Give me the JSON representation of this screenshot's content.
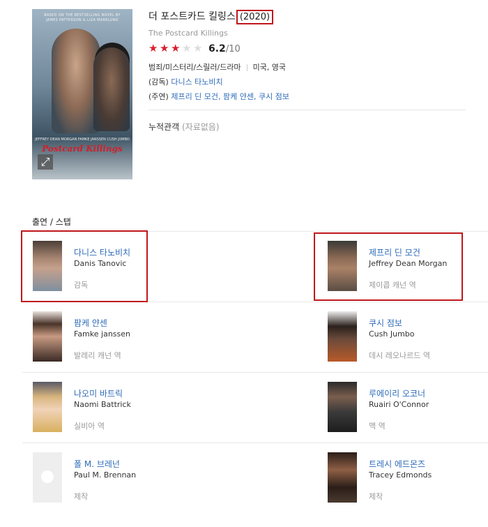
{
  "movie": {
    "title_ko": "더 포스트카드 킬링스",
    "year": "(2020)",
    "title_en": "The Postcard Killings",
    "rating": 6.2,
    "rating_score": "6.2",
    "rating_max": "/10",
    "genres": "범죄/미스터리/스릴러/드라마",
    "countries": "미국, 영국",
    "director_label": "(감독)",
    "director": "다니스 타노비치",
    "cast_label": "(주연)",
    "cast_list": "제프리 딘 모건, 팜케 얀센, 쿠시 점보",
    "audience_label": "누적관객",
    "audience_value": "(자료없음)"
  },
  "poster": {
    "top_credit": "BASED ON THE BESTSELLING NOVEL BY\nJAMES PATTERSON & LIZA MARKLUND",
    "cast_names": "JEFFREY DEAN MORGAN   FAMKE JANSSEN   CUSH JUMBO",
    "title": "Postcard Killings",
    "expand_icon": "expand-icon"
  },
  "section": {
    "title": "출연 / 스탭"
  },
  "people": [
    {
      "name_ko": "다니스 타노비치",
      "name_en": "Danis Tanovic",
      "role": "감독",
      "highlighted": true
    },
    {
      "name_ko": "제프리 딘 모건",
      "name_en": "Jeffrey Dean Morgan",
      "role": "제이콥 캐넌 역",
      "highlighted": true
    },
    {
      "name_ko": "팜케 얀센",
      "name_en": "Famke janssen",
      "role": "발레리 캐넌 역"
    },
    {
      "name_ko": "쿠시 점보",
      "name_en": "Cush Jumbo",
      "role": "데시 레오나르드 역"
    },
    {
      "name_ko": "나오미 바트릭",
      "name_en": "Naomi Battrick",
      "role": "실비아 역"
    },
    {
      "name_ko": "루에이리 오코너",
      "name_en": "Ruairi O'Connor",
      "role": "맥 역"
    },
    {
      "name_ko": "폴 M. 브레넌",
      "name_en": "Paul M. Brennan",
      "role": "제작",
      "no_photo": true
    },
    {
      "name_ko": "트레시 에드몬즈",
      "name_en": "Tracey Edmonds",
      "role": "제작"
    }
  ],
  "colors": {
    "accent_link": "#2d6bb8",
    "star_on": "#d8202d",
    "highlight_box": "#c0171b"
  }
}
